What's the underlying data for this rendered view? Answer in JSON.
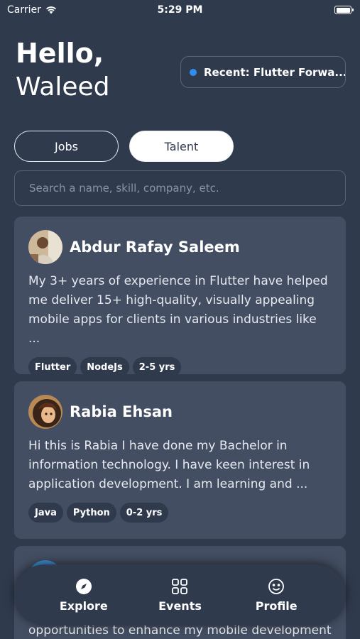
{
  "status_bar": {
    "carrier": "Carrier",
    "time": "5:29 PM"
  },
  "greeting": {
    "line1": "Hello,",
    "line2": "Waleed"
  },
  "recent": {
    "label": "Recent: Flutter Forwa..."
  },
  "tabs": [
    {
      "label": "Jobs",
      "active": false
    },
    {
      "label": "Talent",
      "active": true
    }
  ],
  "search": {
    "placeholder": "Search a name, skill, company, etc.",
    "value": ""
  },
  "profiles": [
    {
      "name": "Abdur Rafay Saleem",
      "bio": "My 3+ years of experience in Flutter have helped me deliver 15+ high-quality, visually appealing mobile apps for clients in various industries like ...",
      "tags": [
        "Flutter",
        "NodeJs",
        "2-5 yrs"
      ]
    },
    {
      "name": "Rabia Ehsan",
      "bio": "Hi this is Rabia I have done my Bachelor in information technology. I have keen interest in application development. I am learning and ...",
      "tags": [
        "Java",
        "Python",
        "0-2 yrs"
      ]
    },
    {
      "bio_tail": "opportunities to enhance my mobile development"
    }
  ],
  "nav": [
    {
      "label": "Explore",
      "icon": "compass-icon"
    },
    {
      "label": "Events",
      "icon": "grid-icon"
    },
    {
      "label": "Profile",
      "icon": "smiley-icon"
    }
  ],
  "colors": {
    "background": "#2f3a4d",
    "card": "#434e62",
    "accent_dot": "#2f8ff0"
  }
}
